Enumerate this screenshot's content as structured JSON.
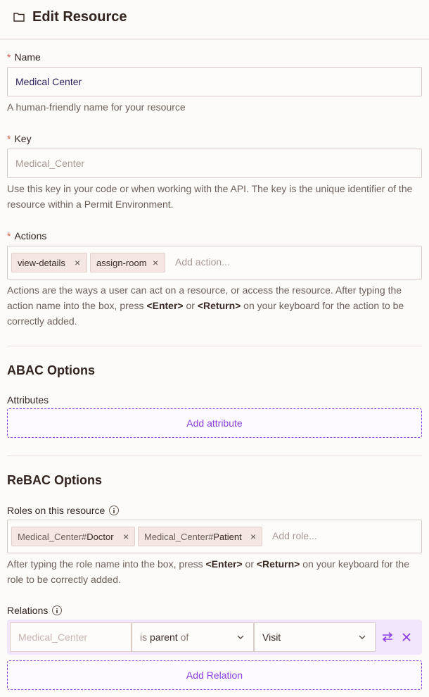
{
  "header": {
    "title": "Edit Resource",
    "icon": "folder-icon"
  },
  "name": {
    "label": "Name",
    "value": "Medical Center",
    "help": "A human-friendly name for your resource"
  },
  "key": {
    "label": "Key",
    "placeholder": "Medical_Center",
    "help": "Use this key in your code or when working with the API. The key is the unique identifier of the resource within a Permit Environment."
  },
  "actions": {
    "label": "Actions",
    "chips": [
      "view-details",
      "assign-room"
    ],
    "placeholder": "Add action...",
    "help_pre": "Actions are the ways a user can act on a resource, or access the resource. After typing the action name into the box, press ",
    "help_key1": "<Enter>",
    "help_or": " or ",
    "help_key2": "<Return>",
    "help_post": " on your keyboard for the action to be correctly added."
  },
  "abac": {
    "title": "ABAC Options",
    "attributes_label": "Attributes",
    "add_attribute": "Add attribute"
  },
  "rebac": {
    "title": "ReBAC Options",
    "roles_label": "Roles on this resource",
    "roles": [
      {
        "prefix": "Medical_Center#",
        "name": "Doctor"
      },
      {
        "prefix": "Medical_Center#",
        "name": "Patient"
      }
    ],
    "roles_placeholder": "Add role...",
    "roles_help_pre": "After typing the role name into the box, press ",
    "roles_help_key1": "<Enter>",
    "roles_help_or": " or ",
    "roles_help_key2": "<Return>",
    "roles_help_post": " on your keyboard for the role to be correctly added.",
    "relations_label": "Relations",
    "relation": {
      "subject_placeholder": "Medical_Center",
      "relation_is": "is ",
      "relation_parent": "parent",
      "relation_of": " of",
      "target": "Visit"
    },
    "add_relation": "Add Relation"
  },
  "colors": {
    "accent": "#8b3dde",
    "required": "#d0594a",
    "relation_row_bg": "#f1e6fb"
  }
}
